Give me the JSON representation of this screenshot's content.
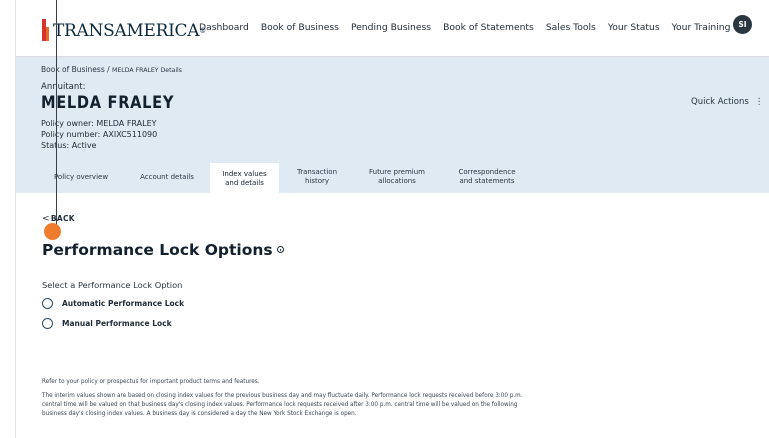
{
  "brand": {
    "name": "TRANSAMERICA",
    "mark": "®"
  },
  "nav": [
    "Dashboard",
    "Book of Business",
    "Pending Business",
    "Book of Statements",
    "Sales Tools",
    "Your Status",
    "Your Training"
  ],
  "user": {
    "initials": "SI"
  },
  "breadcrumb": {
    "root": "Book of Business",
    "sep": " / ",
    "current": "MELDA FRALEY Details"
  },
  "annuitant": {
    "label": "Annuitant:",
    "name": "MELDA FRALEY",
    "owner": "Policy owner: MELDA FRALEY",
    "number": "Policy number: AXIXC511090",
    "status": "Status: Active"
  },
  "quick_actions": {
    "label": "Quick Actions",
    "dots": "⋮"
  },
  "tabs": [
    {
      "line1": "Policy overview",
      "line2": ""
    },
    {
      "line1": "Account details",
      "line2": ""
    },
    {
      "line1": "Index values",
      "line2": "and details"
    },
    {
      "line1": "Transaction",
      "line2": "history"
    },
    {
      "line1": "Future premium",
      "line2": "allocations"
    },
    {
      "line1": "Correspondence",
      "line2": "and statements"
    }
  ],
  "back": {
    "chevron": "<",
    "label": "BACK"
  },
  "page_title": "Performance Lock Options",
  "select_label": "Select a Performance Lock Option",
  "options": [
    "Automatic Performance Lock",
    "Manual Performance Lock"
  ],
  "disclaimer1": "Refer to your policy or prospectus for important product terms and features.",
  "disclaimer2": "The interim values shown are based on closing index values for the previous business day and may fluctuate daily. Performance lock requests received before 3:00 p.m. central time will be valued on that business day's closing index values. Performance lock requests received after 3:00 p.m. central time will be valued on the following business day's closing index values. A business day is considered a day the New York Stock Exchange is open.",
  "colors": {
    "band": "#dfeaf3",
    "callout": "#ef7c2c",
    "logo_red": "#d5342d"
  }
}
